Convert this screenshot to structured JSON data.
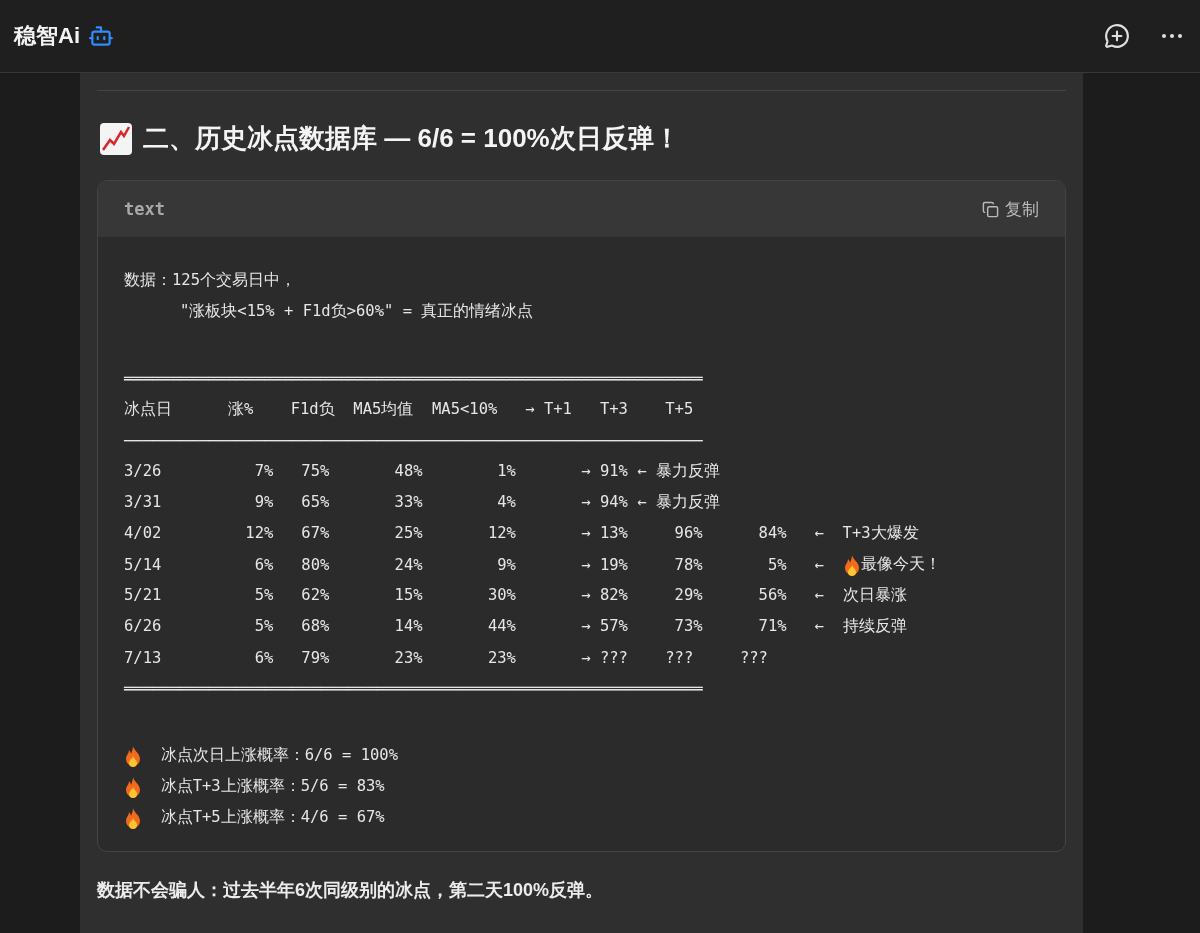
{
  "header": {
    "title": "稳智Ai"
  },
  "section": {
    "heading": "二、历史冰点数据库 — 6/6 = 100%次日反弹！"
  },
  "code_block": {
    "language": "text",
    "copy_label": "复制",
    "blocks": [
      [
        [
          {
            "kind": "text",
            "text": "数据：125个交易日中，"
          }
        ],
        [
          {
            "kind": "text",
            "text": "      \"涨板块<15% + F1d负>60%\" = 真正的情绪冰点"
          }
        ]
      ],
      [
        [
          {
            "kind": "text",
            "text": "══════════════════════════════════════════════════════════════"
          }
        ],
        [
          {
            "kind": "text",
            "text": "冰点日      涨%    F1d负  MA5均值  MA5<10%   → T+1   T+3    T+5"
          }
        ],
        [
          {
            "kind": "text",
            "text": "──────────────────────────────────────────────────────────────"
          }
        ],
        [
          {
            "kind": "text",
            "text": "3/26          7%   75%       48%        1%       → 91% ← 暴力反弹"
          }
        ],
        [
          {
            "kind": "text",
            "text": "3/31          9%   65%       33%        4%       → 94% ← 暴力反弹"
          }
        ],
        [
          {
            "kind": "text",
            "text": "4/02         12%   67%       25%       12%       → 13%     96%      84%   ←  T+3大爆发"
          }
        ],
        [
          {
            "kind": "text",
            "text": "5/14          6%   80%       24%        9%       → 19%     78%       5%   ←  "
          },
          {
            "kind": "fire"
          },
          {
            "kind": "text",
            "text": "最像今天！"
          }
        ],
        [
          {
            "kind": "text",
            "text": "5/21          5%   62%       15%       30%       → 82%     29%      56%   ←  次日暴涨"
          }
        ],
        [
          {
            "kind": "text",
            "text": "6/26          5%   68%       14%       44%       → 57%     73%      71%   ←  持续反弹"
          }
        ],
        [
          {
            "kind": "text",
            "text": "7/13          6%   79%       23%       23%       → ???    ???     ???"
          }
        ],
        [
          {
            "kind": "text",
            "text": "══════════════════════════════════════════════════════════════"
          }
        ]
      ],
      [
        [
          {
            "kind": "fire"
          },
          {
            "kind": "text",
            "text": "  冰点次日上涨概率：6/6 = 100%"
          }
        ],
        [
          {
            "kind": "fire"
          },
          {
            "kind": "text",
            "text": "  冰点T+3上涨概率：5/6 = 83%"
          }
        ],
        [
          {
            "kind": "fire"
          },
          {
            "kind": "text",
            "text": "  冰点T+5上涨概率：4/6 = 67%"
          }
        ]
      ]
    ]
  },
  "summary": "数据不会骗人：过去半年6次同级别的冰点，第二天100%反弹。"
}
